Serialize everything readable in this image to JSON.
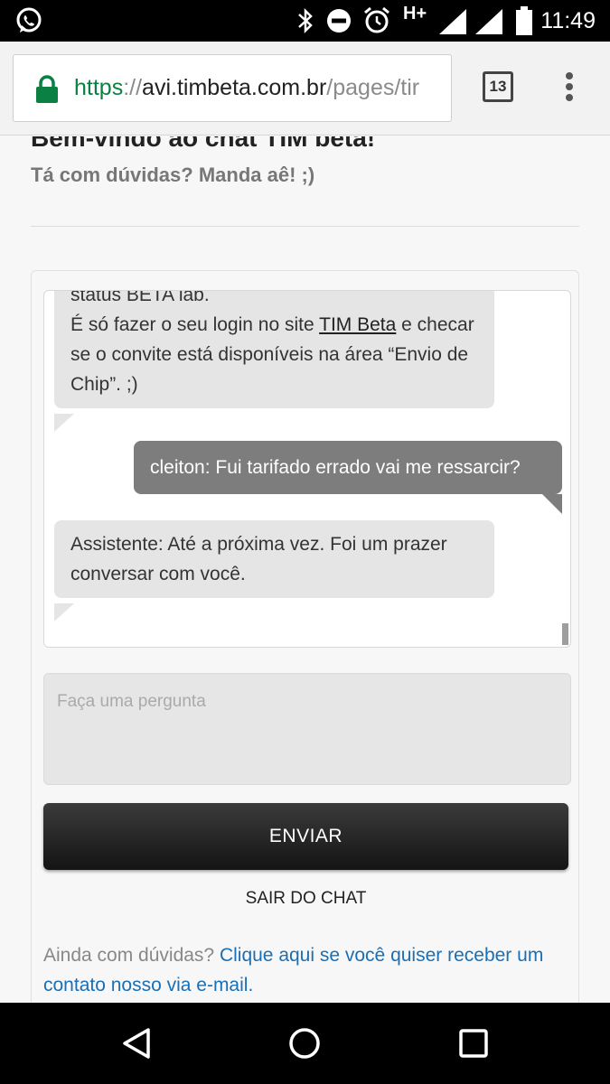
{
  "status_bar": {
    "time": "11:49",
    "network": "H+",
    "icons": [
      "whatsapp-icon",
      "bluetooth-icon",
      "do-not-disturb-icon",
      "alarm-icon",
      "signal-icon",
      "battery-icon"
    ]
  },
  "browser": {
    "url_scheme": "https",
    "url_separator": "://",
    "url_host": "avi.timbeta.com.br",
    "url_path": "/pages/tir",
    "tab_count": "13",
    "secure_color": "#0b8043"
  },
  "page": {
    "title": "Bem-vindo ao chat TIM beta!",
    "subtitle": "Tá com dúvidas? Manda aê! ;)",
    "chat": {
      "messages": [
        {
          "role": "assistant",
          "line_cut": "status BETA lab.",
          "line_before_link": "É só fazer o seu login no site ",
          "link_text": "TIM Beta",
          "line_after_link": " e checar se o convite está disponíveis na área “Envio de Chip”. ;)"
        },
        {
          "role": "user",
          "text": "cleiton: Fui tarifado errado vai me ressarcir?"
        },
        {
          "role": "assistant",
          "text": "Assistente: Até a próxima vez. Foi um prazer conversar com você."
        }
      ]
    },
    "question_placeholder": "Faça uma pergunta",
    "send_label": "ENVIAR",
    "exit_label": "SAIR DO CHAT",
    "help_prefix": "Ainda com dúvidas? ",
    "help_link": "Clique aqui se você quiser receber um contato nosso via e-mail."
  },
  "colors": {
    "bot_bubble": "#e5e5e5",
    "user_bubble": "#7d7d7d",
    "link": "#1a6fb5",
    "button": "#1f1f1f"
  },
  "nav_bar": {
    "icons": [
      "back-icon",
      "home-icon",
      "recents-icon"
    ]
  }
}
